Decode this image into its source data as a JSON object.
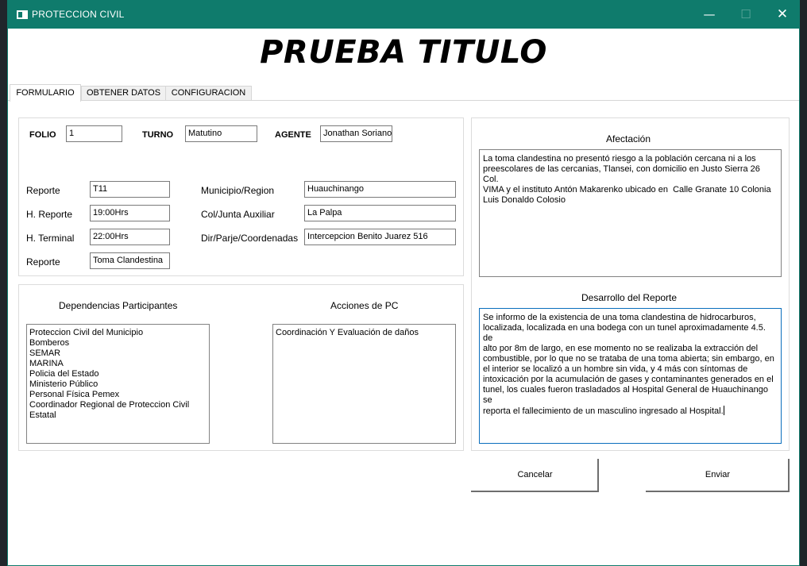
{
  "window": {
    "title": "PROTECCION CIVIL"
  },
  "heading": "PRUEBA TITULO",
  "tabs": [
    {
      "label": "FORMULARIO"
    },
    {
      "label": "OBTENER DATOS"
    },
    {
      "label": "CONFIGURACION"
    }
  ],
  "form": {
    "folio_label": "FOLIO",
    "folio_value": "1",
    "turno_label": "TURNO",
    "turno_value": "Matutino",
    "agente_label": "AGENTE",
    "agente_value": "Jonathan Soriano",
    "reporte_label": "Reporte",
    "reporte_value": "T11",
    "h_reporte_label": "H. Reporte",
    "h_reporte_value": "19:00Hrs",
    "h_terminal_label": "H. Terminal",
    "h_terminal_value": "22:00Hrs",
    "reporte2_label": "Reporte",
    "reporte2_value": "Toma Clandestina",
    "municipio_label": "Municipio/Region",
    "municipio_value": "Huauchinango",
    "col_label": "Col/Junta Auxiliar",
    "col_value": "La Palpa",
    "dir_label": "Dir/Parje/Coordenadas",
    "dir_value": "Intercepcion Benito Juarez 516"
  },
  "dependencias": {
    "label": "Dependencias Participantes",
    "items": [
      "Proteccion Civil del Municipio",
      "Bomberos",
      "SEMAR",
      "MARINA",
      "Policia del Estado",
      "Ministerio Público",
      "Personal Física Pemex",
      "Coordinador Regional de Proteccion Civil",
      "Estatal"
    ]
  },
  "acciones": {
    "label": "Acciones de PC",
    "items": [
      "Coordinación Y Evaluación de daños"
    ]
  },
  "afectacion": {
    "label": "Afectación",
    "text": "La toma clandestina no presentó riesgo a la población cercana ni a los\npreescolares de las cercanias, Tlansei, con domicilio en Justo Sierra 26 Col.\nVIMA y el instituto Antón Makarenko ubicado en  Calle Granate 10 Colonia\nLuis Donaldo Colosio"
  },
  "desarrollo": {
    "label": "Desarrollo del Reporte",
    "text": "Se informo de la existencia de una toma clandestina de hidrocarburos,\nlocalizada, localizada en una bodega con un tunel aproximadamente 4.5. de\nalto por 8m de largo, en ese momento no se realizaba la extracción del\ncombustible, por lo que no se trataba de una toma abierta; sin embargo, en\nel interior se localizó a un hombre sin vida, y 4 más con síntomas de\nintoxicación por la acumulación de gases y contaminantes generados en el\ntunel, los cuales fueron trasladados al Hospital General de Huauchinango se\nreporta el fallecimiento de un masculino ingresado al Hospital."
  },
  "buttons": {
    "cancel": "Cancelar",
    "send": "Enviar"
  },
  "colors": {
    "titlebar": "#0f7b6c",
    "focus": "#0a6ebd"
  }
}
